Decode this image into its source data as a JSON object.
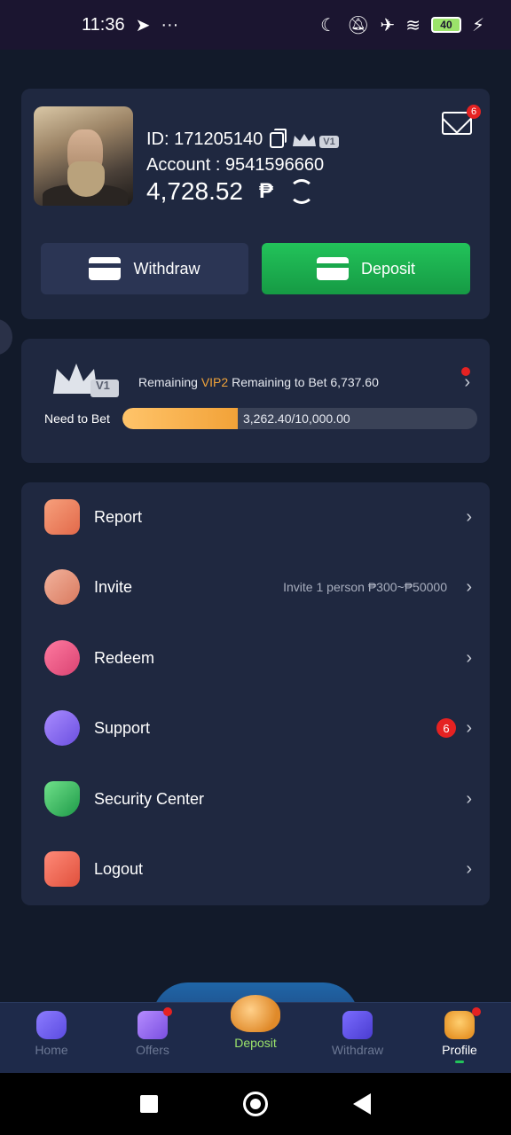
{
  "status_bar": {
    "time": "11:36",
    "battery": "40",
    "icons": [
      "telegram-icon",
      "more-icon",
      "moon-icon",
      "mute-icon",
      "airplane-icon",
      "wifi-icon",
      "battery-icon",
      "charging-icon"
    ]
  },
  "profile": {
    "id_label": "ID: 171205140",
    "vip_level": "V1",
    "account_label": "Account : 9541596660",
    "balance": "4,728.52",
    "currency_symbol": "₱",
    "mail_count": "6"
  },
  "actions": {
    "withdraw_label": "Withdraw",
    "deposit_label": "Deposit"
  },
  "vip": {
    "level": "V1",
    "text_prefix": "Remaining",
    "next_level": "VIP2",
    "text_suffix": "Remaining to Bet 6,737.60",
    "need_label": "Need to Bet",
    "progress_text": "3,262.40/10,000.00",
    "progress_fraction": 0.3262
  },
  "menu": {
    "report": "Report",
    "invite": "Invite",
    "invite_extra": "Invite 1 person ₱300~₱50000",
    "redeem": "Redeem",
    "support": "Support",
    "support_badge": "6",
    "security": "Security Center",
    "logout": "Logout"
  },
  "tabs": {
    "home": "Home",
    "offers": "Offers",
    "deposit": "Deposit",
    "withdraw": "Withdraw",
    "profile": "Profile"
  },
  "colors": {
    "background": "#131a2b",
    "card": "#1f2840",
    "deposit_green": "#22c35a",
    "vip_orange": "#f0a33a",
    "badge_red": "#e52222",
    "tabbar": "#1e2a4a"
  }
}
